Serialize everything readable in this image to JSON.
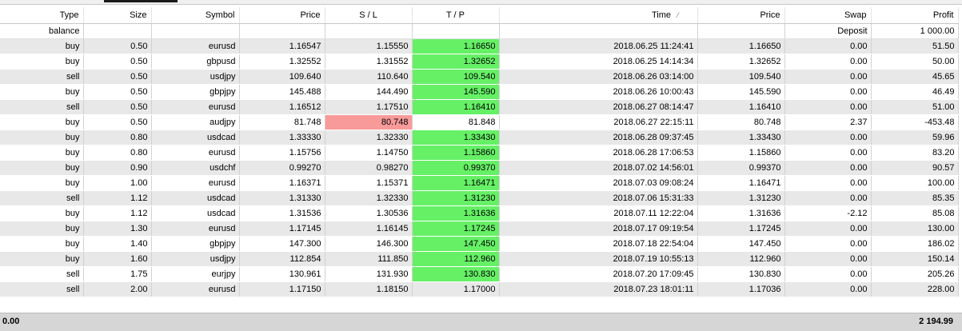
{
  "columns": [
    "Type",
    "Size",
    "Symbol",
    "Price",
    "S / L",
    "T / P",
    "Time",
    "Price",
    "Swap",
    "Profit"
  ],
  "sort_indicator": "⁄",
  "balance_row": {
    "type": "balance",
    "swap": "Deposit",
    "profit": "1 000.00"
  },
  "trades": [
    {
      "type": "buy",
      "size": "0.50",
      "symbol": "eurusd",
      "price": "1.16547",
      "sl": "1.15550",
      "tp": "1.16650",
      "time": "2018.06.25 11:24:41",
      "close": "1.16650",
      "swap": "0.00",
      "profit": "51.50",
      "hit": "tp"
    },
    {
      "type": "buy",
      "size": "0.50",
      "symbol": "gbpusd",
      "price": "1.32552",
      "sl": "1.31552",
      "tp": "1.32652",
      "time": "2018.06.25 14:14:34",
      "close": "1.32652",
      "swap": "0.00",
      "profit": "50.00",
      "hit": "tp"
    },
    {
      "type": "sell",
      "size": "0.50",
      "symbol": "usdjpy",
      "price": "109.640",
      "sl": "110.640",
      "tp": "109.540",
      "time": "2018.06.26 03:14:00",
      "close": "109.540",
      "swap": "0.00",
      "profit": "45.65",
      "hit": "tp"
    },
    {
      "type": "buy",
      "size": "0.50",
      "symbol": "gbpjpy",
      "price": "145.488",
      "sl": "144.490",
      "tp": "145.590",
      "time": "2018.06.26 10:00:43",
      "close": "145.590",
      "swap": "0.00",
      "profit": "46.49",
      "hit": "tp"
    },
    {
      "type": "sell",
      "size": "0.50",
      "symbol": "eurusd",
      "price": "1.16512",
      "sl": "1.17510",
      "tp": "1.16410",
      "time": "2018.06.27 08:14:47",
      "close": "1.16410",
      "swap": "0.00",
      "profit": "51.00",
      "hit": "tp"
    },
    {
      "type": "buy",
      "size": "0.50",
      "symbol": "audjpy",
      "price": "81.748",
      "sl": "80.748",
      "tp": "81.848",
      "time": "2018.06.27 22:15:11",
      "close": "80.748",
      "swap": "2.37",
      "profit": "-453.48",
      "hit": "sl"
    },
    {
      "type": "buy",
      "size": "0.80",
      "symbol": "usdcad",
      "price": "1.33330",
      "sl": "1.32330",
      "tp": "1.33430",
      "time": "2018.06.28 09:37:45",
      "close": "1.33430",
      "swap": "0.00",
      "profit": "59.96",
      "hit": "tp"
    },
    {
      "type": "buy",
      "size": "0.80",
      "symbol": "eurusd",
      "price": "1.15756",
      "sl": "1.14750",
      "tp": "1.15860",
      "time": "2018.06.28 17:06:53",
      "close": "1.15860",
      "swap": "0.00",
      "profit": "83.20",
      "hit": "tp"
    },
    {
      "type": "buy",
      "size": "0.90",
      "symbol": "usdchf",
      "price": "0.99270",
      "sl": "0.98270",
      "tp": "0.99370",
      "time": "2018.07.02 14:56:01",
      "close": "0.99370",
      "swap": "0.00",
      "profit": "90.57",
      "hit": "tp"
    },
    {
      "type": "buy",
      "size": "1.00",
      "symbol": "eurusd",
      "price": "1.16371",
      "sl": "1.15371",
      "tp": "1.16471",
      "time": "2018.07.03 09:08:24",
      "close": "1.16471",
      "swap": "0.00",
      "profit": "100.00",
      "hit": "tp"
    },
    {
      "type": "sell",
      "size": "1.12",
      "symbol": "usdcad",
      "price": "1.31330",
      "sl": "1.32330",
      "tp": "1.31230",
      "time": "2018.07.06 15:31:33",
      "close": "1.31230",
      "swap": "0.00",
      "profit": "85.35",
      "hit": "tp"
    },
    {
      "type": "buy",
      "size": "1.12",
      "symbol": "usdcad",
      "price": "1.31536",
      "sl": "1.30536",
      "tp": "1.31636",
      "time": "2018.07.11 12:22:04",
      "close": "1.31636",
      "swap": "-2.12",
      "profit": "85.08",
      "hit": "tp"
    },
    {
      "type": "buy",
      "size": "1.30",
      "symbol": "eurusd",
      "price": "1.17145",
      "sl": "1.16145",
      "tp": "1.17245",
      "time": "2018.07.17 09:19:54",
      "close": "1.17245",
      "swap": "0.00",
      "profit": "130.00",
      "hit": "tp"
    },
    {
      "type": "buy",
      "size": "1.40",
      "symbol": "gbpjpy",
      "price": "147.300",
      "sl": "146.300",
      "tp": "147.450",
      "time": "2018.07.18 22:54:04",
      "close": "147.450",
      "swap": "0.00",
      "profit": "186.02",
      "hit": "tp"
    },
    {
      "type": "buy",
      "size": "1.60",
      "symbol": "usdjpy",
      "price": "112.854",
      "sl": "111.850",
      "tp": "112.960",
      "time": "2018.07.19 10:55:13",
      "close": "112.960",
      "swap": "0.00",
      "profit": "150.14",
      "hit": "tp"
    },
    {
      "type": "sell",
      "size": "1.75",
      "symbol": "eurjpy",
      "price": "130.961",
      "sl": "131.930",
      "tp": "130.830",
      "time": "2018.07.20 17:09:45",
      "close": "130.830",
      "swap": "0.00",
      "profit": "205.26",
      "hit": "tp"
    },
    {
      "type": "sell",
      "size": "2.00",
      "symbol": "eurusd",
      "price": "1.17150",
      "sl": "1.18150",
      "tp": "1.17000",
      "time": "2018.07.23 18:01:11",
      "close": "1.17036",
      "swap": "0.00",
      "profit": "228.00",
      "hit": "none"
    }
  ],
  "footer": {
    "left_total": "0.00",
    "profit_total": "2 194.99"
  },
  "colors": {
    "tp_hit": "#66f066",
    "sl_hit": "#f89a9a",
    "row_alt": "#e8e8e8",
    "footer_bg": "#d6d6d6"
  }
}
